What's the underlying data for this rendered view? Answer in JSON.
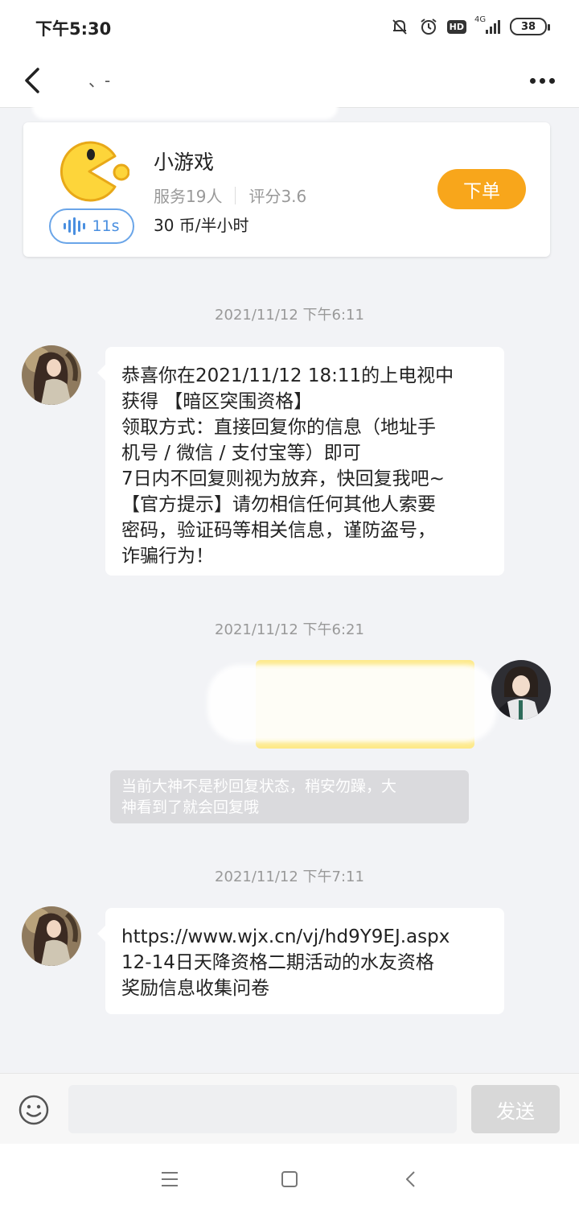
{
  "status_bar": {
    "time": "下午5:30",
    "network_label": "4G",
    "hd_label": "HD",
    "battery": "38",
    "icons": [
      "mute-bell-icon",
      "alarm-icon",
      "hd-icon",
      "signal-icon",
      "battery-icon"
    ]
  },
  "nav": {
    "title": "、-",
    "back_icon": "chevron-left-icon",
    "more_icon": "more-dots-icon"
  },
  "service_card": {
    "name": "小游戏",
    "served": "服务19人",
    "rating": "评分3.6",
    "price": "30 币/半小时",
    "voice_duration": "11s",
    "order_label": "下单",
    "accent_color": "#f8a61b",
    "voice_color": "#4a8fe0"
  },
  "messages": [
    {
      "timestamp": "2021/11/12 下午6:11",
      "side": "left",
      "lines": [
        "恭喜你在2021/11/12 18:11的上电视中",
        "获得 【暗区突围资格】",
        "领取方式：直接回复你的信息（地址手",
        "机号 / 微信 / 支付宝等）即可",
        "7日内不回复则视为放弃，快回复我吧~",
        "【官方提示】请勿相信任何其他人索要",
        "密码，验证码等相关信息，谨防盗号，",
        "诈骗行为！"
      ]
    },
    {
      "timestamp": "2021/11/12 下午6:21",
      "side": "right",
      "redacted": true
    },
    {
      "timestamp": "2021/11/12 下午7:11",
      "side": "left",
      "lines": [
        "https://www.wjx.cn/vj/hd9Y9EJ.aspx",
        "12-14日天降资格二期活动的水友资格",
        "奖励信息收集问卷"
      ]
    }
  ],
  "notice": {
    "lines": [
      "当前大神不是秒回复状态，稍安勿躁，大",
      "神看到了就会回复哦"
    ]
  },
  "composer": {
    "placeholder": "",
    "send_label": "发送",
    "emoji_icon": "smiley-icon"
  },
  "system_nav": {
    "icons": [
      "menu-icon",
      "home-square-icon",
      "back-triangle-icon"
    ]
  }
}
